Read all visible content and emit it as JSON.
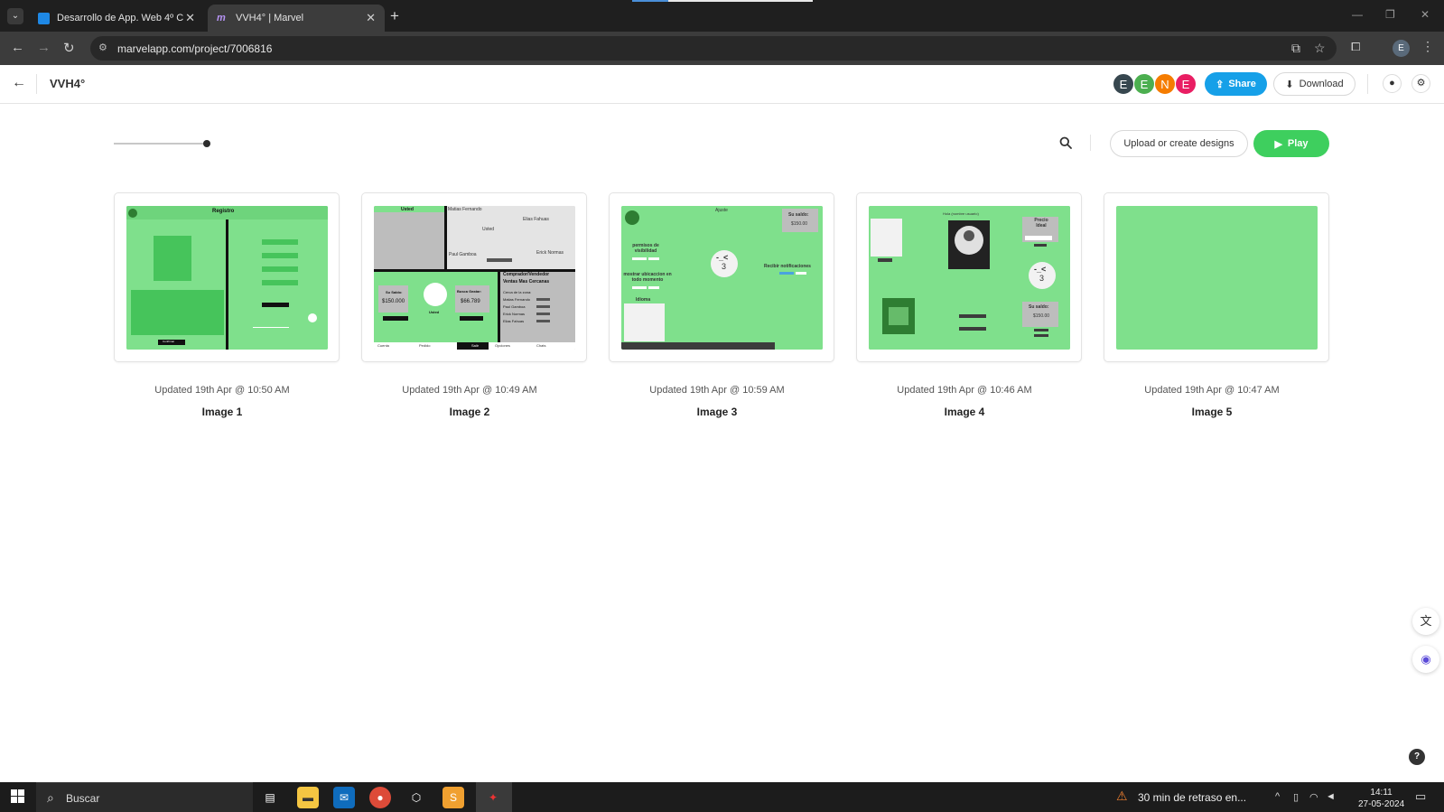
{
  "browser": {
    "tabs": [
      {
        "title": "Desarrollo de App. Web 4º C",
        "close": "✕"
      },
      {
        "title": "VVH4° | Marvel",
        "close": "✕"
      }
    ],
    "new_tab": "+",
    "url": "marvelapp.com/project/7006816",
    "profile_initial": "E"
  },
  "app": {
    "project_title": "VVH4°",
    "collaborators": [
      {
        "initial": "E",
        "color": "#37474f"
      },
      {
        "initial": "E",
        "color": "#4caf50"
      },
      {
        "initial": "N",
        "color": "#f57c00"
      },
      {
        "initial": "E",
        "color": "#e91e63"
      }
    ],
    "share_label": "Share",
    "download_label": "Download",
    "upload_label": "Upload or create designs",
    "play_label": "Play",
    "zoom_level": 1.0
  },
  "cards": [
    {
      "name": "Image 1",
      "updated": "Updated 19th Apr @ 10:50 AM",
      "thumb": {
        "title": "Registro",
        "btn": "Confirmar"
      }
    },
    {
      "name": "Image 2",
      "updated": "Updated 19th Apr @ 10:49 AM",
      "thumb": {
        "usted": "Usted",
        "matias": "Matias Fernando",
        "elias": "Elias Fahuas",
        "paul": "Paul Gamboa",
        "erick": "Erick Normas",
        "saldo_label": "Su Saldo:",
        "saldo": "$150.000",
        "gastar_label": "Busca Gastar:",
        "gastar": "$66.789",
        "comprador": "Comprador/Vendedor",
        "ventas": "Ventas Mas Cercanas",
        "cerca": "Cerca de la zona:",
        "list": [
          "Matias Fernando",
          "Paul Gamboa",
          "Erick Normas",
          "Elias Fahuas"
        ],
        "tabs": [
          "Cuenta",
          "Pedido",
          "Salir",
          "Opciones",
          "Chats"
        ]
      }
    },
    {
      "name": "Image 3",
      "updated": "Updated 19th Apr @ 10:59 AM",
      "thumb": {
        "title": "Ajuste",
        "saldo": "Su saldo:",
        "saldo_val": "$150.00",
        "permisos": "permisos de visibilidad",
        "mostrar": "mostrar ubicaccion en todo momento",
        "idioma": "Idioma",
        "notif": "Recibir notificaciones",
        "face": "-_<\n3"
      }
    },
    {
      "name": "Image 4",
      "updated": "Updated 19th Apr @ 10:46 AM",
      "thumb": {
        "hola": "Hola (nombre usuario)",
        "precio": "Precio Ideal",
        "saldo": "Su saldo:",
        "saldo_val": "$150.00",
        "face": "-_<\n3"
      }
    },
    {
      "name": "Image 5",
      "updated": "Updated 19th Apr @ 10:47 AM",
      "thumb": {}
    }
  ],
  "taskbar": {
    "search_placeholder": "Buscar",
    "notification": "30 min de retraso en...",
    "time": "14:11",
    "date": "27-05-2024"
  },
  "colors": {
    "accent_share": "#16a0e8",
    "play_green": "#3ecf5e",
    "thumb_green": "#7fe08c"
  }
}
